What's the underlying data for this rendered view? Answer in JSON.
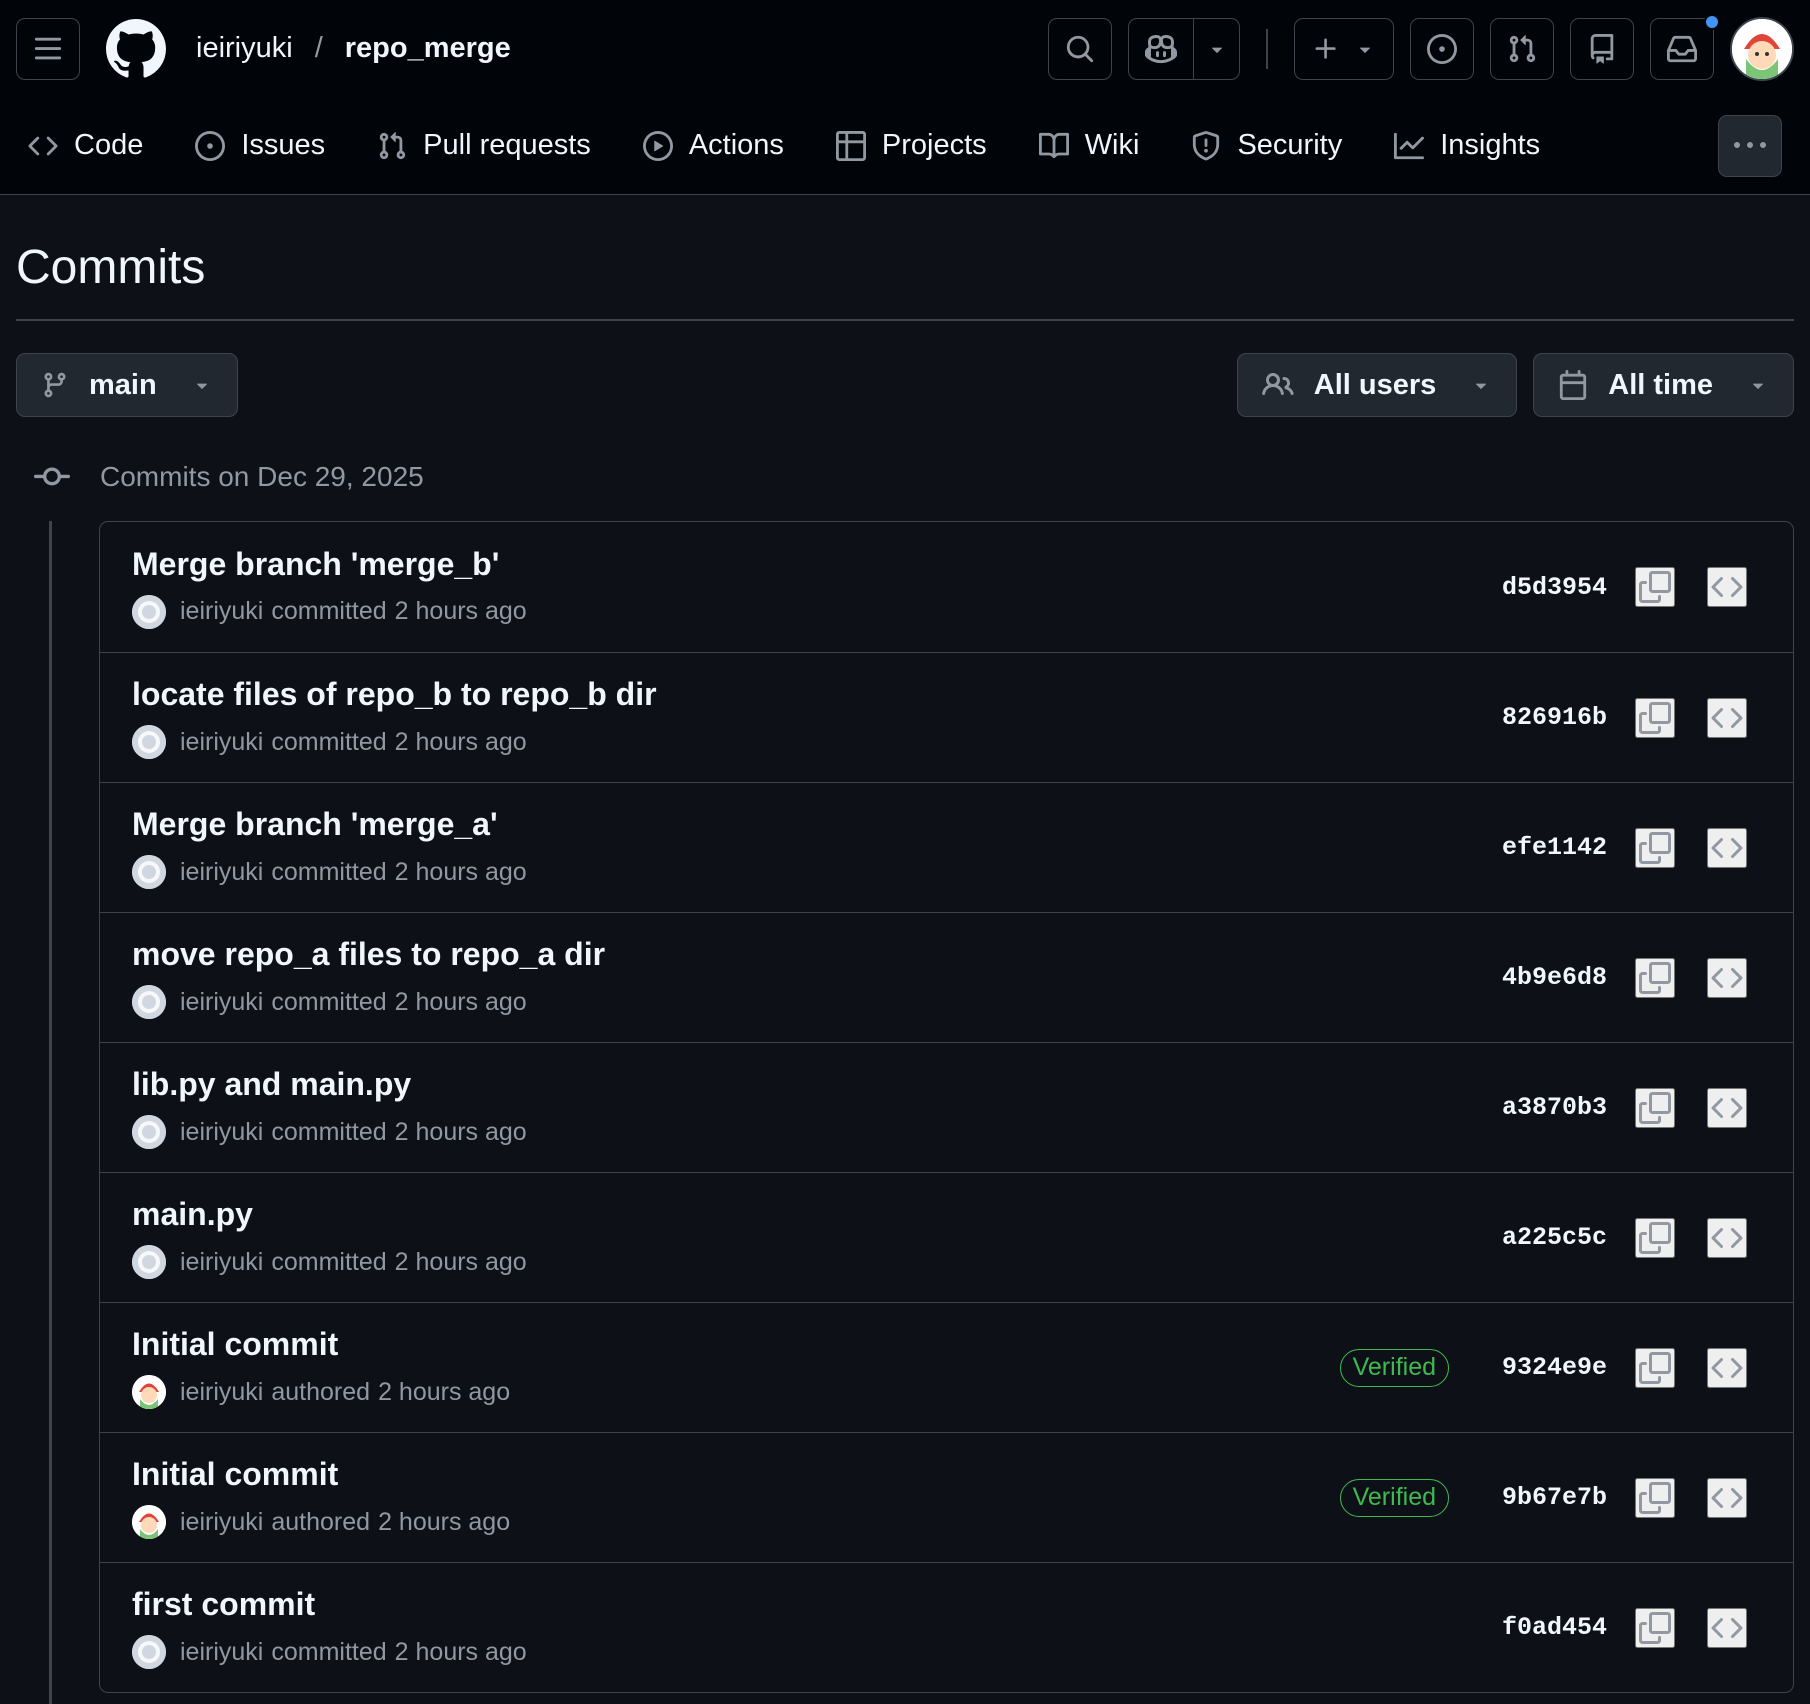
{
  "header": {
    "owner": "ieiriyuki",
    "separator": "/",
    "repo": "repo_merge",
    "accent_color": "#4493f8"
  },
  "nav": {
    "items": [
      {
        "label": "Code",
        "icon": "code-icon"
      },
      {
        "label": "Issues",
        "icon": "issue-icon"
      },
      {
        "label": "Pull requests",
        "icon": "pull-request-icon"
      },
      {
        "label": "Actions",
        "icon": "play-icon"
      },
      {
        "label": "Projects",
        "icon": "table-icon"
      },
      {
        "label": "Wiki",
        "icon": "book-icon"
      },
      {
        "label": "Security",
        "icon": "shield-icon"
      },
      {
        "label": "Insights",
        "icon": "graph-icon"
      }
    ]
  },
  "page": {
    "title": "Commits"
  },
  "filters": {
    "branch": "main",
    "users": "All users",
    "time": "All time"
  },
  "day": {
    "label": "Commits on Dec 29, 2025"
  },
  "commits": [
    {
      "message": "Merge branch 'merge_b'",
      "author": "ieiriyuki",
      "verb": "committed",
      "time": "2 hours ago",
      "sha": "d5d3954",
      "verified": ""
    },
    {
      "message": "locate files of repo_b to repo_b dir",
      "author": "ieiriyuki",
      "verb": "committed",
      "time": "2 hours ago",
      "sha": "826916b",
      "verified": ""
    },
    {
      "message": "Merge branch 'merge_a'",
      "author": "ieiriyuki",
      "verb": "committed",
      "time": "2 hours ago",
      "sha": "efe1142",
      "verified": ""
    },
    {
      "message": "move repo_a files to repo_a dir",
      "author": "ieiriyuki",
      "verb": "committed",
      "time": "2 hours ago",
      "sha": "4b9e6d8",
      "verified": ""
    },
    {
      "message": "lib.py and main.py",
      "author": "ieiriyuki",
      "verb": "committed",
      "time": "2 hours ago",
      "sha": "a3870b3",
      "verified": ""
    },
    {
      "message": "main.py",
      "author": "ieiriyuki",
      "verb": "committed",
      "time": "2 hours ago",
      "sha": "a225c5c",
      "verified": ""
    },
    {
      "message": "Initial commit",
      "author": "ieiriyuki",
      "verb": "authored",
      "time": "2 hours ago",
      "sha": "9324e9e",
      "verified": "Verified"
    },
    {
      "message": "Initial commit",
      "author": "ieiriyuki",
      "verb": "authored",
      "time": "2 hours ago",
      "sha": "9b67e7b",
      "verified": "Verified"
    },
    {
      "message": "first commit",
      "author": "ieiriyuki",
      "verb": "committed",
      "time": "2 hours ago",
      "sha": "f0ad454",
      "verified": ""
    }
  ]
}
